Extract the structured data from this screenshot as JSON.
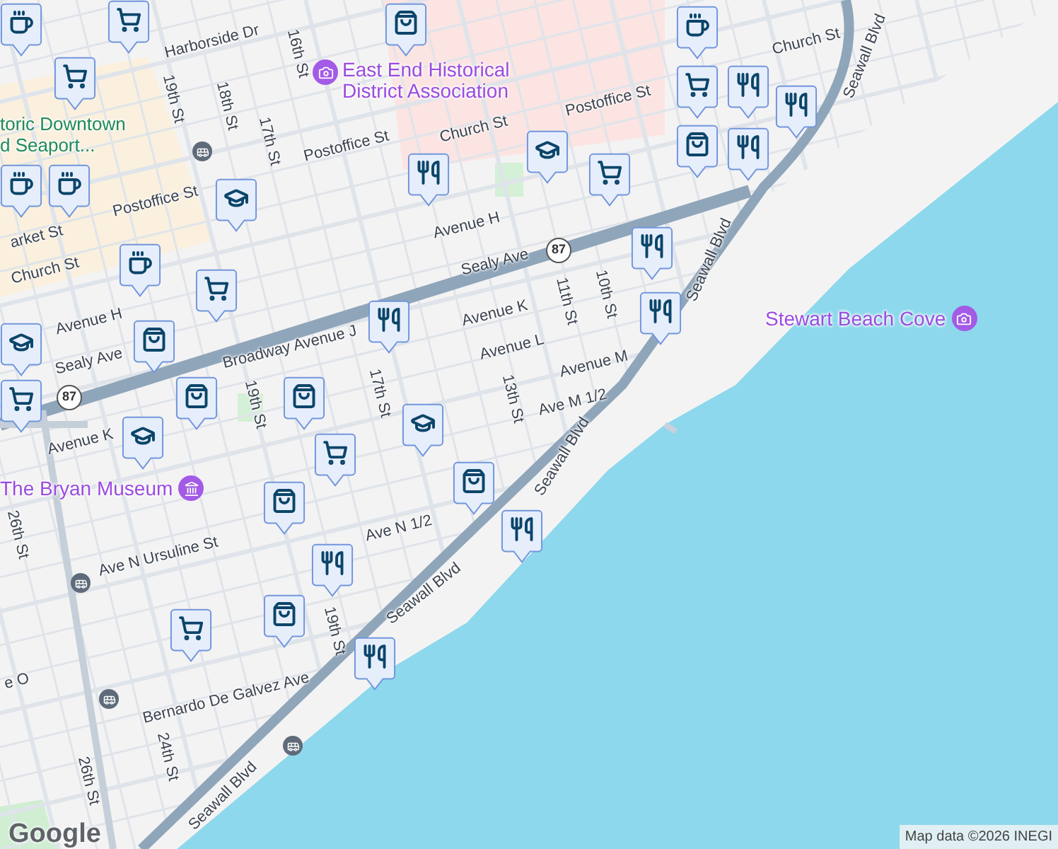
{
  "map": {
    "street_labels": [
      {
        "text": "Harborside Dr"
      },
      {
        "text": "19th St"
      },
      {
        "text": "18th St"
      },
      {
        "text": "16th St"
      },
      {
        "text": "17th St"
      },
      {
        "text": "Postoffice St"
      },
      {
        "text": "Church St"
      },
      {
        "text": "Postoffice St"
      },
      {
        "text": "Church St"
      },
      {
        "text": "Postoffice St"
      },
      {
        "text": "arket St"
      },
      {
        "text": "Church St"
      },
      {
        "text": "Avenue H"
      },
      {
        "text": "Sealy Ave"
      },
      {
        "text": "Avenue H"
      },
      {
        "text": "Sealy Ave"
      },
      {
        "text": "Broadway Avenue J"
      },
      {
        "text": "Avenue K"
      },
      {
        "text": "Avenue L"
      },
      {
        "text": "11th St"
      },
      {
        "text": "10th St"
      },
      {
        "text": "17th St"
      },
      {
        "text": "19th St"
      },
      {
        "text": "13th St"
      },
      {
        "text": "Avenue M"
      },
      {
        "text": "Ave M 1/2"
      },
      {
        "text": "Avenue K"
      },
      {
        "text": "26th St"
      },
      {
        "text": "Ave N Ursuline St"
      },
      {
        "text": "Ave N 1/2"
      },
      {
        "text": "19th St"
      },
      {
        "text": "Bernardo De Galvez Ave"
      },
      {
        "text": "24th St"
      },
      {
        "text": "26th St"
      },
      {
        "text": "e O"
      },
      {
        "text": "Seawall Blvd"
      },
      {
        "text": "Seawall Blvd"
      },
      {
        "text": "Seawall Blvd"
      },
      {
        "text": "Seawall Blvd"
      },
      {
        "text": "Seawall Blvd"
      }
    ],
    "poi_labels": [
      {
        "kind": "historical",
        "text": "East End Historical District Association"
      },
      {
        "kind": "district",
        "text": "toric Downtown d Seaport..."
      },
      {
        "kind": "beach",
        "text": "Stewart Beach Cove"
      },
      {
        "kind": "museum",
        "text": "The Bryan Museum"
      }
    ],
    "route_shields": [
      "87",
      "87"
    ],
    "markers": [
      {
        "kind": "cup"
      },
      {
        "kind": "cart"
      },
      {
        "kind": "cart"
      },
      {
        "kind": "bag"
      },
      {
        "kind": "cup"
      },
      {
        "kind": "cart"
      },
      {
        "kind": "fork"
      },
      {
        "kind": "fork"
      },
      {
        "kind": "bag"
      },
      {
        "kind": "fork"
      },
      {
        "kind": "cap"
      },
      {
        "kind": "fork"
      },
      {
        "kind": "cup"
      },
      {
        "kind": "cup"
      },
      {
        "kind": "cup"
      },
      {
        "kind": "cap"
      },
      {
        "kind": "cart"
      },
      {
        "kind": "cart"
      },
      {
        "kind": "fork"
      },
      {
        "kind": "fork"
      },
      {
        "kind": "bag"
      },
      {
        "kind": "bag"
      },
      {
        "kind": "bag"
      },
      {
        "kind": "fork"
      },
      {
        "kind": "cap"
      },
      {
        "kind": "cart"
      },
      {
        "kind": "cap"
      },
      {
        "kind": "cart"
      },
      {
        "kind": "cap"
      },
      {
        "kind": "bag"
      },
      {
        "kind": "bag"
      },
      {
        "kind": "fork"
      },
      {
        "kind": "fork"
      },
      {
        "kind": "bag"
      },
      {
        "kind": "fork"
      },
      {
        "kind": "cart"
      }
    ],
    "logo": "Google",
    "attribution": "Map data ©2026 INEGI"
  }
}
